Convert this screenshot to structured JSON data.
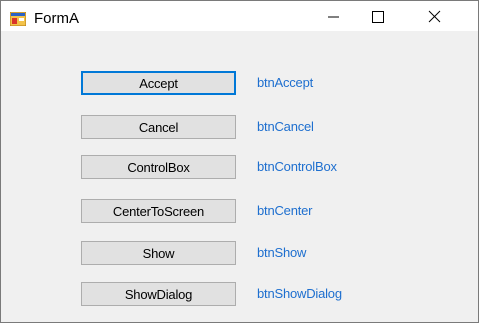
{
  "window": {
    "title": "FormA",
    "icon": "windows-form-icon",
    "controls": {
      "minimize_icon": "minimize-icon",
      "maximize_icon": "maximize-icon",
      "close_icon": "close-icon"
    }
  },
  "buttons": [
    {
      "label": "Accept",
      "name": "btnAccept",
      "default": true
    },
    {
      "label": "Cancel",
      "name": "btnCancel",
      "default": false
    },
    {
      "label": "ControlBox",
      "name": "btnControlBox",
      "default": false
    },
    {
      "label": "CenterToScreen",
      "name": "btnCenter",
      "default": false
    },
    {
      "label": "Show",
      "name": "btnShow",
      "default": false
    },
    {
      "label": "ShowDialog",
      "name": "btnShowDialog",
      "default": false
    }
  ],
  "colors": {
    "label_text": "#1e6fcf",
    "focus_border": "#0078d7",
    "button_face": "#e1e1e1",
    "form_background": "#f0f0f0"
  }
}
